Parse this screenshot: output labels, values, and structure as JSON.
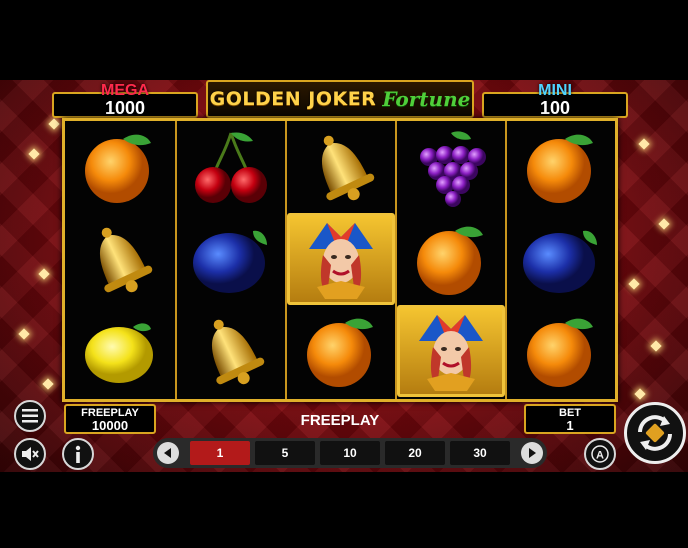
{
  "jackpots": {
    "mega": {
      "label": "MEGA",
      "value": "1000"
    },
    "mini": {
      "label": "MINI",
      "value": "100"
    }
  },
  "logo": {
    "part1": "GOLDEN JOKER",
    "part2": "Fortune"
  },
  "reels": [
    [
      "orange-icon",
      "bell-icon",
      "lemon-icon"
    ],
    [
      "cherry-icon",
      "plum-icon",
      "bell-icon"
    ],
    [
      "bell-icon",
      "joker-icon",
      "orange-icon"
    ],
    [
      "grapes-icon",
      "orange-icon",
      "joker-icon"
    ],
    [
      "orange-icon",
      "plum-icon",
      "orange-icon"
    ]
  ],
  "freeplay_box": {
    "label": "FREEPLAY",
    "value": "10000"
  },
  "status_text": "FREEPLAY",
  "bet_box": {
    "label": "BET",
    "value": "1"
  },
  "stakes": {
    "options": [
      "1",
      "5",
      "10",
      "20",
      "30"
    ],
    "selected": "1"
  },
  "colors": {
    "accent_gold": "#d9a520",
    "mega": "#ff2a4c",
    "mini": "#4fd4ff",
    "selected_stake": "#b31a1a"
  }
}
